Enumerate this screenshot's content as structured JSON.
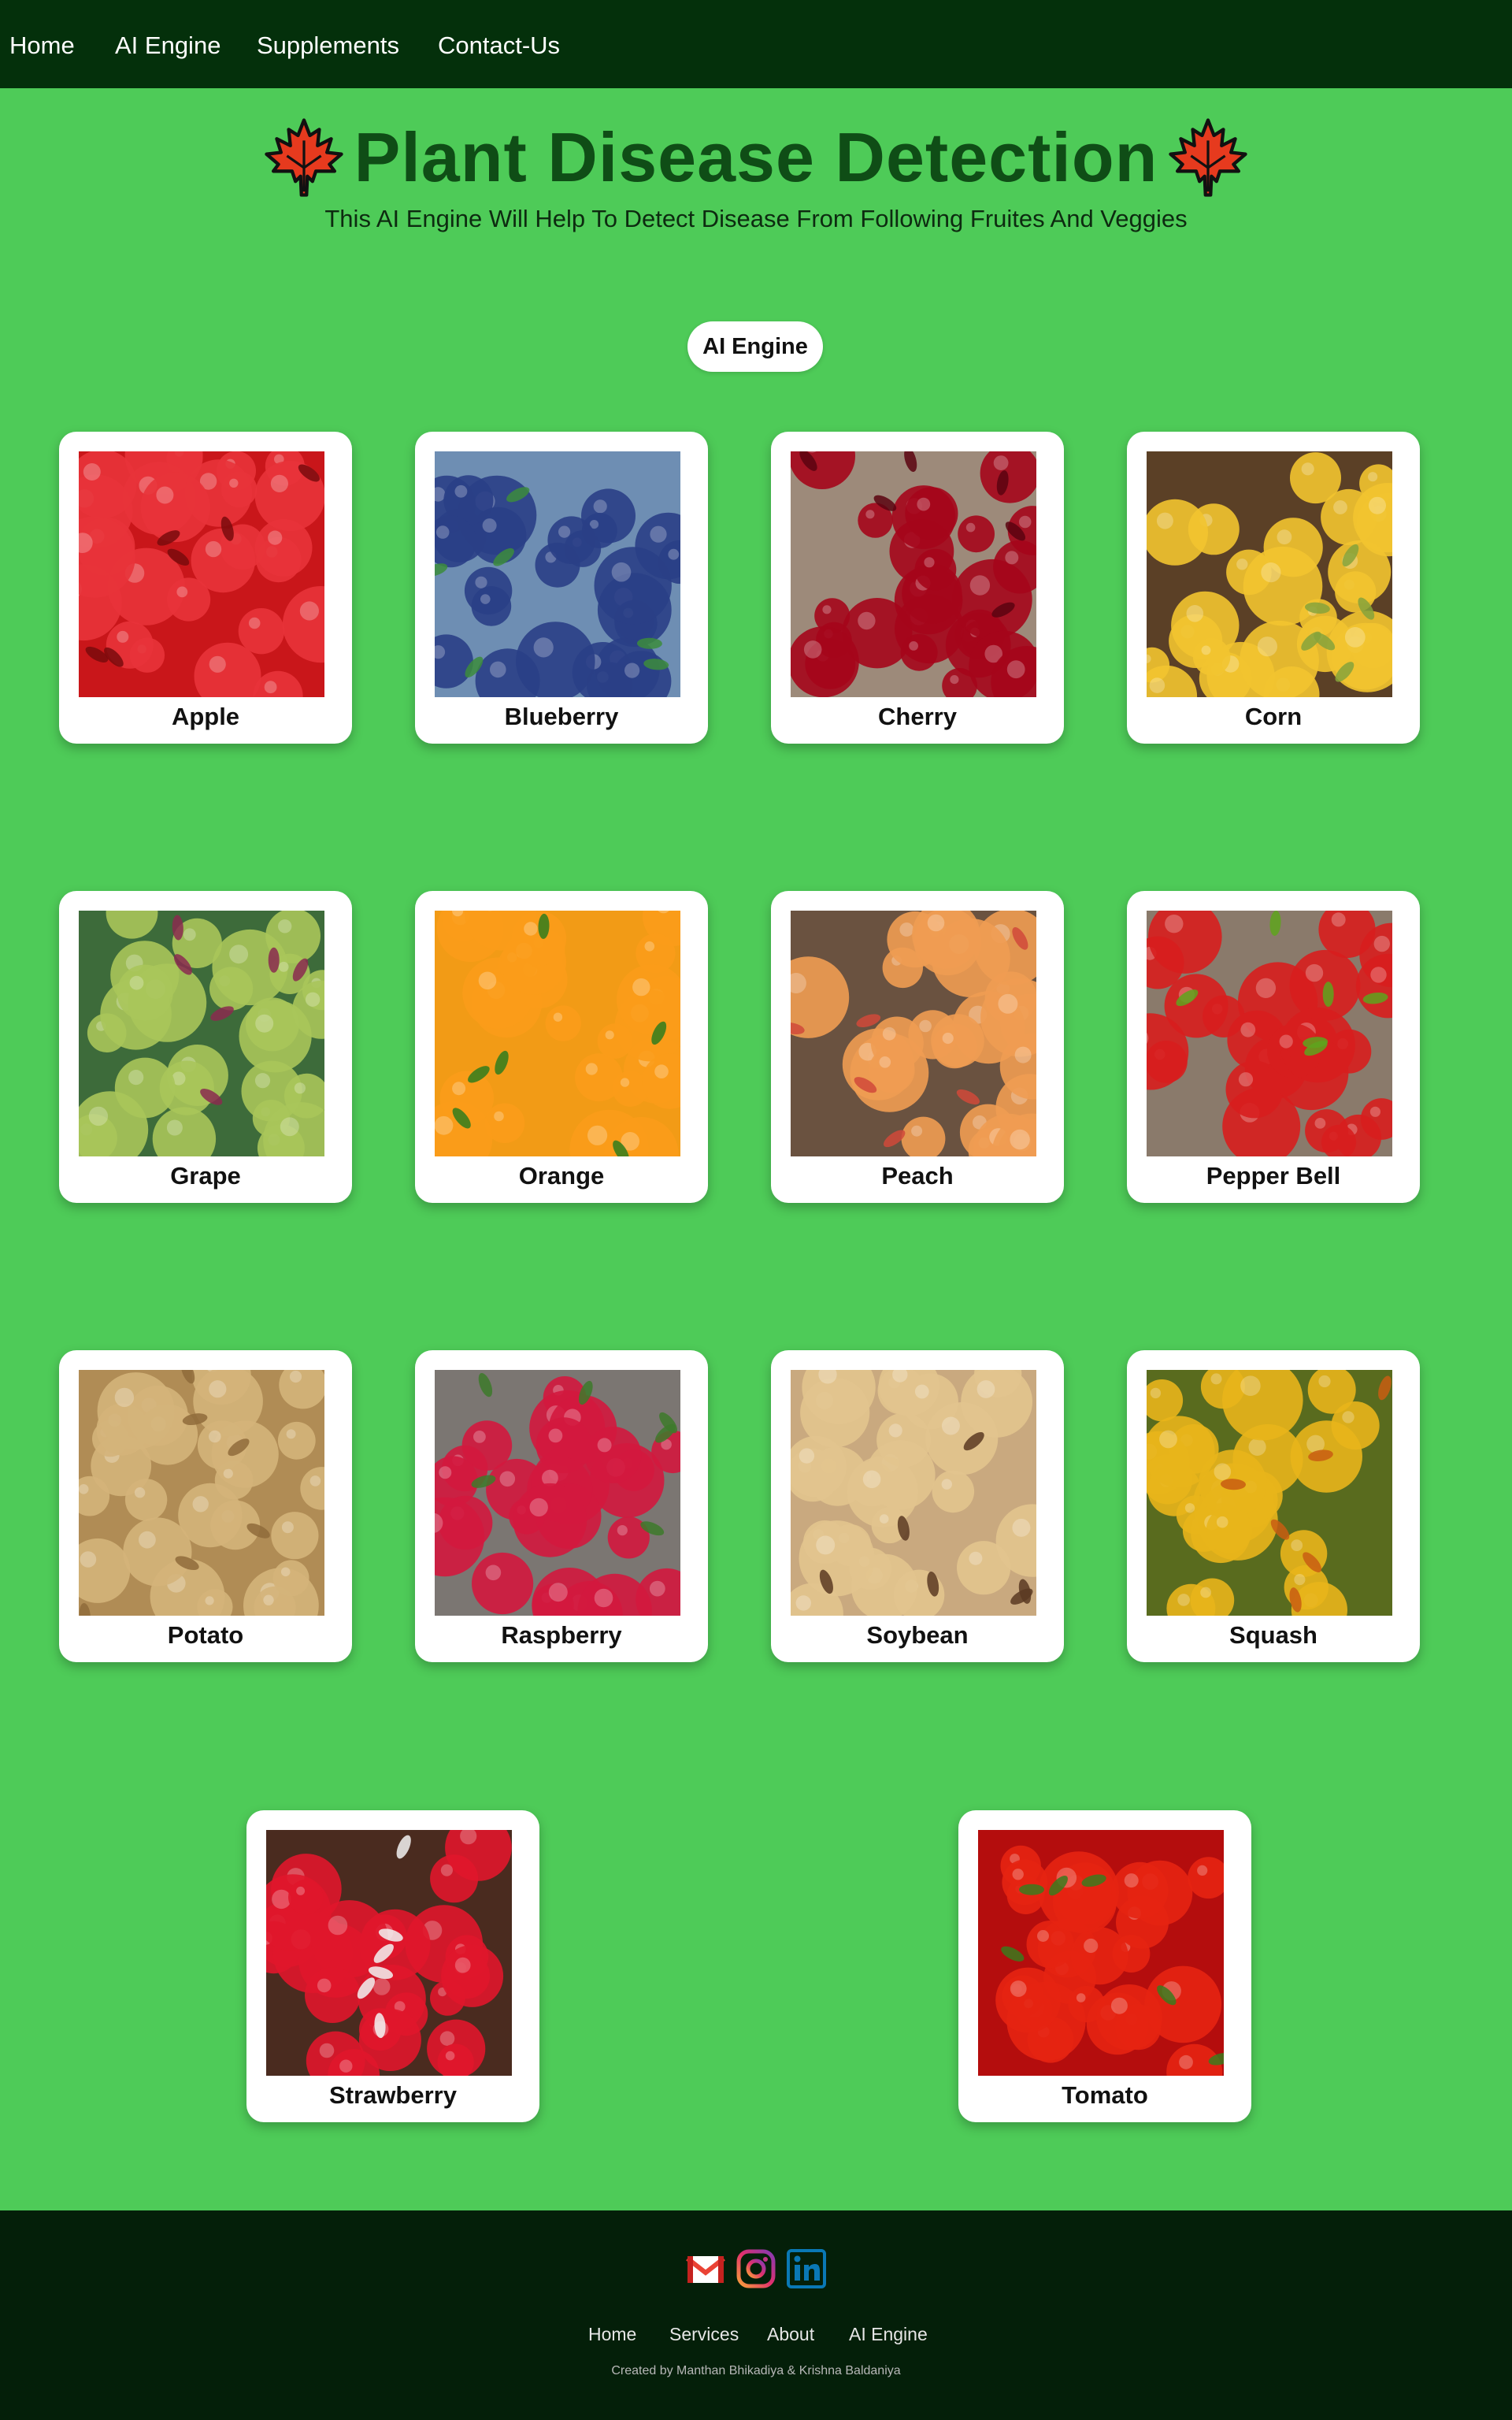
{
  "nav": {
    "items": [
      {
        "label": "Home"
      },
      {
        "label": "AI Engine"
      },
      {
        "label": "Supplements"
      },
      {
        "label": "Contact-Us"
      }
    ]
  },
  "hero": {
    "title": "Plant Disease Detection",
    "subtitle": "This AI Engine Will Help To Detect Disease From Following Fruites And Veggies",
    "icon": "maple-leaf-icon"
  },
  "engine_button": {
    "label": "AI Engine"
  },
  "crops": [
    {
      "name": "Apple",
      "bg": "#c9161a",
      "fg": "#e8333a",
      "accent": "#7a0b0d"
    },
    {
      "name": "Blueberry",
      "bg": "#6e8eb3",
      "fg": "#2a3f86",
      "accent": "#3c8c3c"
    },
    {
      "name": "Cherry",
      "bg": "#9d8a7a",
      "fg": "#a5061b",
      "accent": "#5c0410"
    },
    {
      "name": "Corn",
      "bg": "#5b4026",
      "fg": "#f2c430",
      "accent": "#86a33b"
    },
    {
      "name": "Grape",
      "bg": "#3d6b3a",
      "fg": "#a8c55a",
      "accent": "#8a2a4f"
    },
    {
      "name": "Orange",
      "bg": "#f29b16",
      "fg": "#fb9c19",
      "accent": "#2f7d1d"
    },
    {
      "name": "Peach",
      "bg": "#6a5240",
      "fg": "#ef9c52",
      "accent": "#d0493a"
    },
    {
      "name": "Pepper Bell",
      "bg": "#8a7a6b",
      "fg": "#d71e1e",
      "accent": "#5ea51d"
    },
    {
      "name": "Potato",
      "bg": "#b08c55",
      "fg": "#d4b47a",
      "accent": "#8f6b3b"
    },
    {
      "name": "Raspberry",
      "bg": "#7b7672",
      "fg": "#d3183e",
      "accent": "#3d7a2a"
    },
    {
      "name": "Soybean",
      "bg": "#c9a97f",
      "fg": "#e2c48e",
      "accent": "#5a3a22"
    },
    {
      "name": "Squash",
      "bg": "#596b1e",
      "fg": "#e8b51b",
      "accent": "#c85d12"
    },
    {
      "name": "Strawberry",
      "bg": "#4a2b1f",
      "fg": "#e0162b",
      "accent": "#f2f2f2"
    },
    {
      "name": "Tomato",
      "bg": "#b40d0d",
      "fg": "#e62312",
      "accent": "#3b7a1d"
    }
  ],
  "footer": {
    "social": [
      "gmail-icon",
      "instagram-icon",
      "linkedin-icon"
    ],
    "links": [
      {
        "label": "Home"
      },
      {
        "label": "Services"
      },
      {
        "label": "About"
      },
      {
        "label": "AI Engine"
      }
    ],
    "credit": "Created by Manthan Bhikadiya & Krishna Baldaniya"
  },
  "colors": {
    "page_bg": "#4ecb58",
    "nav_bg": "#04300b",
    "footer_bg": "#041f09",
    "title": "#0f4d16"
  }
}
